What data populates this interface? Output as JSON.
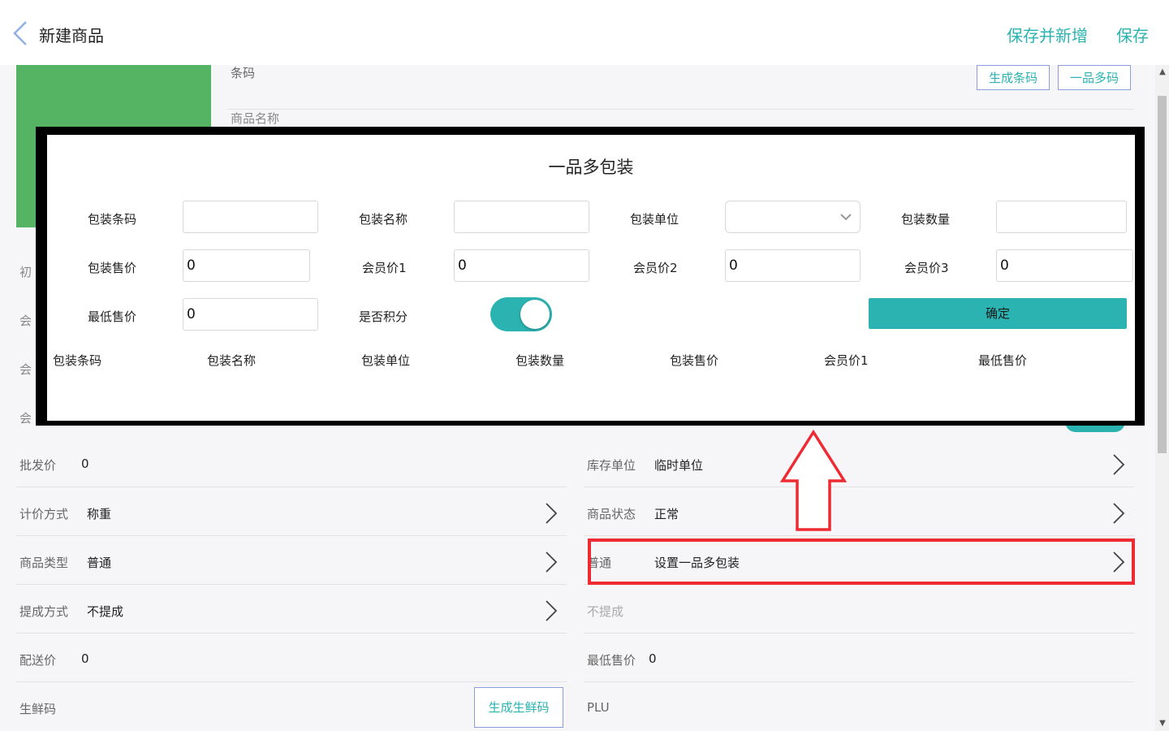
{
  "header": {
    "title": "新建商品",
    "save_and_new": "保存并新增",
    "save": "保存"
  },
  "form_top": {
    "barcode_label": "条码",
    "gen_barcode": "生成条码",
    "multi_barcode": "一品多码",
    "name_label": "商品名称"
  },
  "partials": [
    "初",
    "会",
    "会",
    "会"
  ],
  "rows_left": [
    {
      "label": "批发价",
      "value": "0"
    },
    {
      "label": "计价方式",
      "value": "称重"
    },
    {
      "label": "商品类型",
      "value": "普通"
    },
    {
      "label": "提成方式",
      "value": "不提成"
    },
    {
      "label": "配送价",
      "value": "0"
    },
    {
      "label": "生鲜码",
      "button": "生成生鲜码"
    }
  ],
  "rows_right": [
    {
      "label": "库存单位",
      "value": "临时单位"
    },
    {
      "label": "商品状态",
      "value": "正常"
    },
    {
      "label": "普通",
      "value": "设置一品多包装"
    },
    {
      "label": "不提成"
    },
    {
      "label": "最低售价",
      "value": "0"
    },
    {
      "label": "PLU"
    }
  ],
  "modal": {
    "title": "一品多包装",
    "fields": {
      "pkg_barcode": {
        "label": "包装条码",
        "value": ""
      },
      "pkg_name": {
        "label": "包装名称",
        "value": ""
      },
      "pkg_unit": {
        "label": "包装单位",
        "value": ""
      },
      "pkg_qty": {
        "label": "包装数量",
        "value": ""
      },
      "pkg_price": {
        "label": "包装售价",
        "value": "0"
      },
      "member1": {
        "label": "会员价1",
        "value": "0"
      },
      "member2": {
        "label": "会员价2",
        "value": "0"
      },
      "member3": {
        "label": "会员价3",
        "value": "0"
      },
      "min_price": {
        "label": "最低售价",
        "value": "0"
      },
      "points": {
        "label": "是否积分"
      }
    },
    "confirm": "确定",
    "table_headers": [
      "包装条码",
      "包装名称",
      "包装单位",
      "包装数量",
      "包装售价",
      "会员价1",
      "最低售价"
    ]
  },
  "colors": {
    "accent": "#2bb3b1",
    "image_bg": "#55b464",
    "annotation": "#ee2b33"
  }
}
